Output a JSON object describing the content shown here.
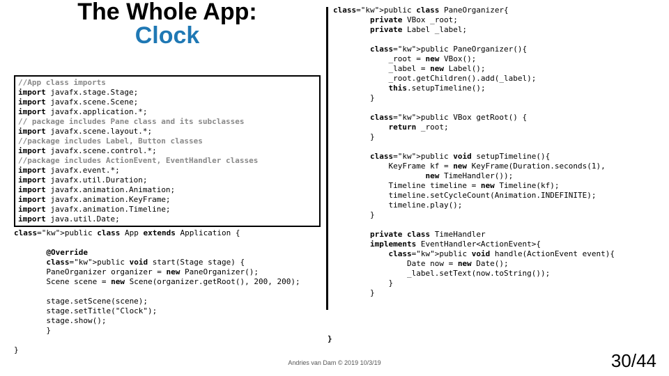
{
  "title": {
    "line1": "The Whole App:",
    "line2": "Clock"
  },
  "leftBoxed": "//App class imports\nimport javafx.stage.Stage;\nimport javafx.scene.Scene;\nimport javafx.application.*;\n// package includes Pane class and its subclasses\nimport javafx.scene.layout.*;\n//package includes Label, Button classes\nimport javafx.scene.control.*;\n//package includes ActionEvent, EventHandler classes\nimport javafx.event.*;\nimport javafx.util.Duration;\nimport javafx.animation.Animation;\nimport javafx.animation.KeyFrame;\nimport javafx.animation.Timeline;\nimport java.util.Date;",
  "leftBelow": "public class App extends Application {\n\n       @Override\n       public void start(Stage stage) {\n       PaneOrganizer organizer = new PaneOrganizer();\n       Scene scene = new Scene(organizer.getRoot(), 200, 200);\n\n       stage.setScene(scene);\n       stage.setTitle(\"Clock\");\n       stage.show();\n       }\n\n}",
  "rightCode": "public class PaneOrganizer{\n        private VBox _root;\n        private Label _label;\n\n        public PaneOrganizer(){\n            _root = new VBox();\n            _label = new Label();\n            _root.getChildren().add(_label);\n            this.setupTimeline();\n        }\n\n        public VBox getRoot() {\n            return _root;\n        }\n\n        public void setupTimeline(){\n            KeyFrame kf = new KeyFrame(Duration.seconds(1),\n                    new TimeHandler());\n            Timeline timeline = new Timeline(kf);\n            timeline.setCycleCount(Animation.INDEFINITE);\n            timeline.play();\n        }\n\n        private class TimeHandler\n        implements EventHandler<ActionEvent>{\n            public void handle(ActionEvent event){\n                Date now = new Date();\n                _label.setText(now.toString());\n            }\n        }\n",
  "closebrace": "}",
  "footer": "Andries van Dam © 2019 10/3/19",
  "page": "30/44"
}
